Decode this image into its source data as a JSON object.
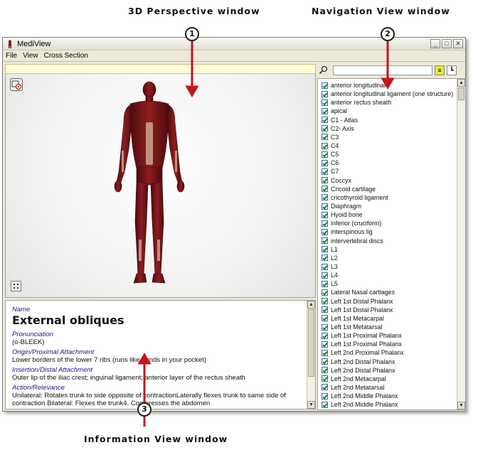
{
  "callouts": {
    "perspective": "3D Perspective window",
    "navigation": "Navigation View window",
    "information": "Information View window"
  },
  "markers": [
    "1",
    "2",
    "3"
  ],
  "window": {
    "title": "MediView",
    "menu": [
      "File",
      "View",
      "Cross Section"
    ]
  },
  "info": {
    "name_label": "Name",
    "name": "External obliques",
    "pronunciation_label": "Pronunciation",
    "pronunciation": "(o-BLEEK)",
    "origin_label": "Origin/Proximal Attachment",
    "origin": "Lower borders of the lower 7 ribs (runs like hands in your pocket)",
    "insertion_label": "Insertion/Distal Attachment",
    "insertion": "Outer lip of the iliac crest; inguinal ligament; anterior layer of the rectus sheath",
    "action_label": "Action/Relevance",
    "action": "Unilateral: Rotates trunk to side opposite of contractionLaterally flexes trunk to same side of contraction Bilateral: Flexes the trunk4. Compresses the abdomen"
  },
  "nav_items": [
    "anterior longitudinal",
    "anterior longitudinal ligament (one structure)",
    "anterior rectus sheath",
    "apical",
    "C1 - Atlas",
    "C2- Axis",
    "C3",
    "C4",
    "C5",
    "C6",
    "C7",
    "Coccyx",
    "Cricoid cartilage",
    "cricothyroid ligament",
    "Diaphragm",
    "Hyoid bone",
    "inferior (cruciform)",
    "interspinous lig",
    "intervertebral discs",
    "L1",
    "L2",
    "L3",
    "L4",
    "L5",
    "Lateral Nasal cartlages",
    "Left 1st Distal Phalanx",
    "Left 1st Distal Phalanx",
    "Left 1st Metacarpal",
    "Left 1st Metatarsal",
    "Left 1st Proximal Phalanx",
    "Left 1st Proximal Phalanx",
    "Left 2nd  Proximal Phalanx",
    "Left 2nd Distal Phalanx",
    "Left 2nd Distal Phalanx",
    "Left 2nd Metacarpal",
    "Left 2nd Metatarsal",
    "Left 2nd Middle Phalanx",
    "Left 2nd Middle Phalanx"
  ],
  "colors": {
    "muscle": "#7a1416",
    "yellow_bar": "#fefcd2",
    "window_bg": "#ece9d8"
  }
}
